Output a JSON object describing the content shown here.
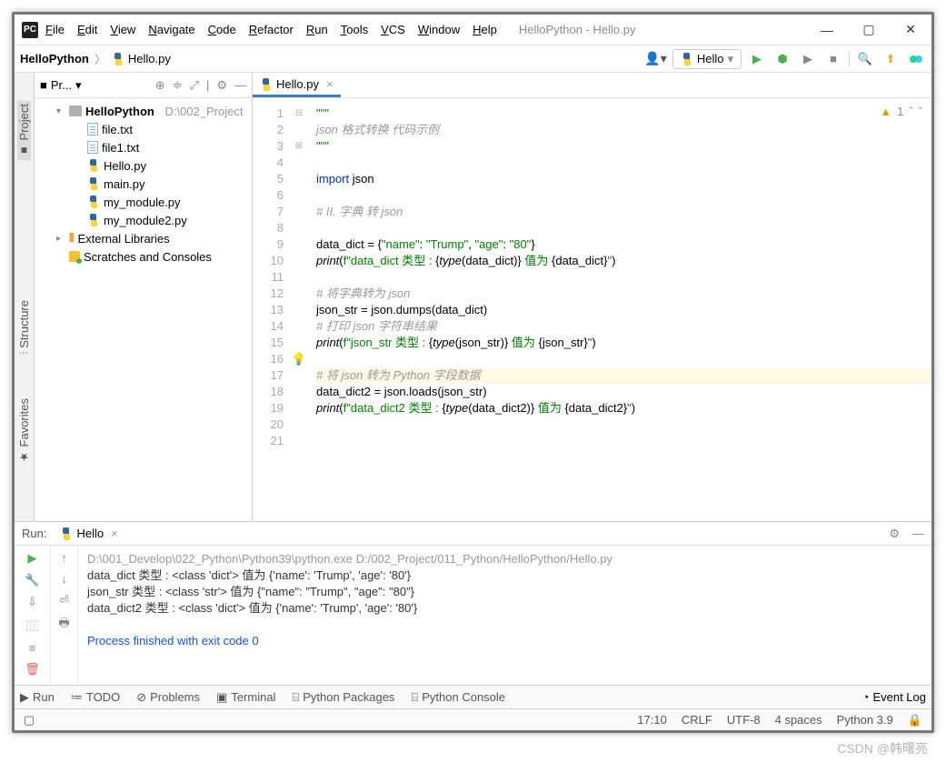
{
  "title": "HelloPython - Hello.py",
  "menu": [
    "File",
    "Edit",
    "View",
    "Navigate",
    "Code",
    "Refactor",
    "Run",
    "Tools",
    "VCS",
    "Window",
    "Help"
  ],
  "breadcrumb": {
    "project": "HelloPython",
    "file": "Hello.py"
  },
  "run_config": "Hello",
  "sidebar": {
    "header": "Pr...",
    "project_name": "HelloPython",
    "project_path": "D:\\002_Project",
    "files": [
      "file.txt",
      "file1.txt",
      "Hello.py",
      "main.py",
      "my_module.py",
      "my_module2.py"
    ],
    "ext_lib": "External Libraries",
    "scratches": "Scratches and Consoles"
  },
  "editor": {
    "tab": "Hello.py",
    "warn_count": "1",
    "lines": [
      {
        "n": 1,
        "html": "<span class='str'>\"\"\"</span>",
        "fold": "⊟"
      },
      {
        "n": 2,
        "html": "<span class='cm'>json 格式转换 代码示例</span>"
      },
      {
        "n": 3,
        "html": "<span class='str'>\"\"\"</span>",
        "fold": "⊞"
      },
      {
        "n": 4,
        "html": ""
      },
      {
        "n": 5,
        "html": "<span class='kw'>import</span> json"
      },
      {
        "n": 6,
        "html": ""
      },
      {
        "n": 7,
        "html": "<span class='cm'># II. 字典 转 json</span>"
      },
      {
        "n": 8,
        "html": ""
      },
      {
        "n": 9,
        "html": "data_dict = {<span class='str'>\"name\"</span>: <span class='str'>\"Trump\"</span>, <span class='str'>\"age\"</span>: <span class='str'>\"80\"</span>}"
      },
      {
        "n": 10,
        "html": "<span class='fn'>print</span>(<span class='str'>f\"data_dict 类型 : </span>{<span class='fn'>type</span>(data_dict)}<span class='str'> 值为 </span>{data_dict}<span class='str'>\"</span>)"
      },
      {
        "n": 11,
        "html": ""
      },
      {
        "n": 12,
        "html": "<span class='cm'># 将字典转为 json</span>"
      },
      {
        "n": 13,
        "html": "json_str = json.dumps(data_dict)"
      },
      {
        "n": 14,
        "html": "<span class='cm'># 打印 json 字符串结果</span>"
      },
      {
        "n": 15,
        "html": "<span class='fn'>print</span>(<span class='str'>f\"json_str 类型 : </span>{<span class='fn'>type</span>(json_str)}<span class='str'> 值为 </span>{json_str}<span class='str'>\"</span>)"
      },
      {
        "n": 16,
        "html": "",
        "bulb": true
      },
      {
        "n": 17,
        "html": "<span class='cm'># 将 json 转为 Python 字段数据</span>",
        "hl": true
      },
      {
        "n": 18,
        "html": "data_dict2 = json.loads(json_str)"
      },
      {
        "n": 19,
        "html": "<span class='fn'>print</span>(<span class='str'>f\"data_dict2 类型 : </span>{<span class='fn'>type</span>(data_dict2)}<span class='str'> 值为 </span>{data_dict2}<span class='str'>\"</span>)"
      },
      {
        "n": 20,
        "html": ""
      },
      {
        "n": 21,
        "html": ""
      }
    ]
  },
  "run": {
    "label": "Run:",
    "tab": "Hello",
    "output": [
      {
        "t": "path",
        "v": "D:\\001_Develop\\022_Python\\Python39\\python.exe D:/002_Project/011_Python/HelloPython/Hello.py"
      },
      {
        "t": "",
        "v": "data_dict 类型 : <class 'dict'> 值为 {'name': 'Trump', 'age': '80'}"
      },
      {
        "t": "",
        "v": "json_str 类型 : <class 'str'> 值为 {\"name\": \"Trump\", \"age\": \"80\"}"
      },
      {
        "t": "",
        "v": "data_dict2 类型 : <class 'dict'> 值为 {'name': 'Trump', 'age': '80'}"
      },
      {
        "t": "",
        "v": ""
      },
      {
        "t": "blue",
        "v": "Process finished with exit code 0"
      }
    ]
  },
  "bottom_tabs": [
    "Run",
    "TODO",
    "Problems",
    "Terminal",
    "Python Packages",
    "Python Console"
  ],
  "event_log": "Event Log",
  "status": {
    "pos": "17:10",
    "eol": "CRLF",
    "enc": "UTF-8",
    "indent": "4 spaces",
    "sdk": "Python 3.9"
  },
  "left_tabs": [
    "Project",
    "Structure",
    "Favorites"
  ],
  "watermark": "CSDN @韩曙亮"
}
